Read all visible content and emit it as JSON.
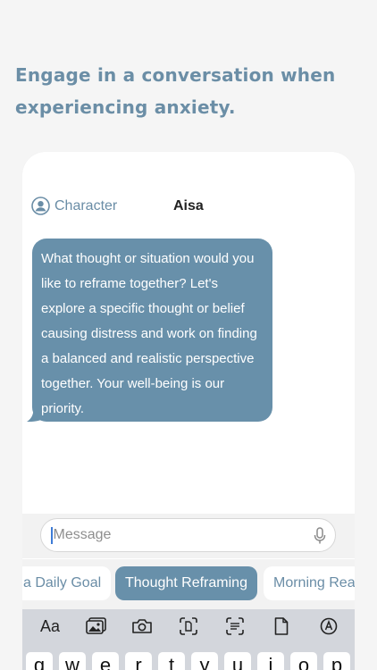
{
  "headline": "Engage in a conversation when experiencing anxiety.",
  "chat": {
    "character_label": "Character",
    "title": "Aisa",
    "message": "What thought or situation would you like to reframe together? Let's explore a specific thought or belief causing distress and work on finding a balanced and realistic perspective together. Your well-being is our priority."
  },
  "input": {
    "placeholder": "Message"
  },
  "chips": [
    {
      "label": "a Daily Goal"
    },
    {
      "label": "Thought Reframing"
    },
    {
      "label": "Morning Rea"
    }
  ],
  "keyboard": {
    "toolbar_text_label": "Aa",
    "keys": [
      "q",
      "w",
      "e",
      "r",
      "t",
      "y",
      "u",
      "i",
      "o",
      "p"
    ]
  },
  "colors": {
    "accent": "#6890aa",
    "headline": "#6b8ea6",
    "background": "#f5f5f5"
  }
}
